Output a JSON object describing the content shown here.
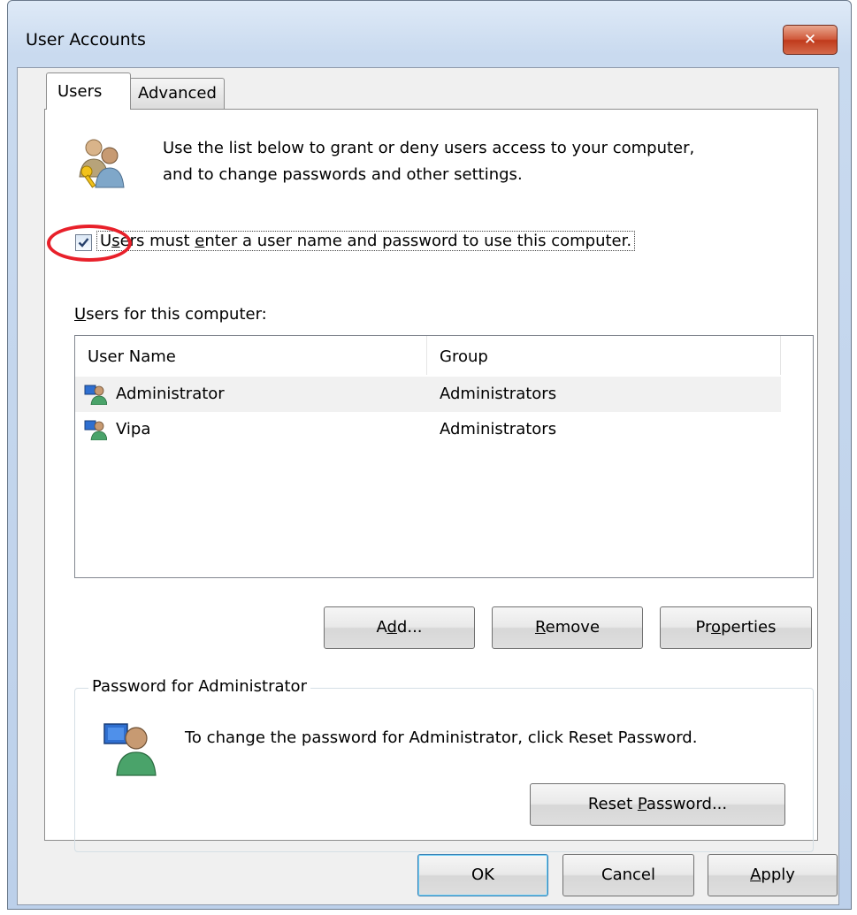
{
  "window": {
    "title": "User Accounts",
    "close_glyph": "✕"
  },
  "tabs": [
    {
      "label": "Users",
      "selected": true
    },
    {
      "label": "Advanced",
      "selected": false
    }
  ],
  "users_tab": {
    "intro_line1": "Use the list below to grant or deny users access to your computer,",
    "intro_line2": "and to change passwords and other settings.",
    "require_login": {
      "checked": true,
      "label_before": "U",
      "label_u1": "s",
      "label_mid": "ers must ",
      "label_u2": "e",
      "label_after": "nter a user name and password to use this computer."
    },
    "list_title_u": "U",
    "list_title_rest": "sers for this computer:",
    "columns": [
      "User Name",
      "Group"
    ],
    "rows": [
      {
        "name": "Administrator",
        "group": "Administrators",
        "icon": "user-icon"
      },
      {
        "name": "Vipa",
        "group": "Administrators",
        "icon": "user-icon"
      }
    ],
    "buttons": {
      "add_pre": "A",
      "add_u": "d",
      "add_post": "d...",
      "remove_u": "R",
      "remove_post": "emove",
      "props_pre": "Pr",
      "props_u": "o",
      "props_post": "perties"
    },
    "password_group": {
      "legend": "Password for Administrator",
      "text": "To change the password for Administrator, click Reset Password.",
      "reset_pre": "Reset ",
      "reset_u": "P",
      "reset_post": "assword..."
    }
  },
  "footer": {
    "ok": "OK",
    "cancel": "Cancel",
    "apply_u": "A",
    "apply_post": "pply"
  },
  "colors": {
    "annotation_circle": "#e8202a",
    "close_button": "#c73e20"
  }
}
